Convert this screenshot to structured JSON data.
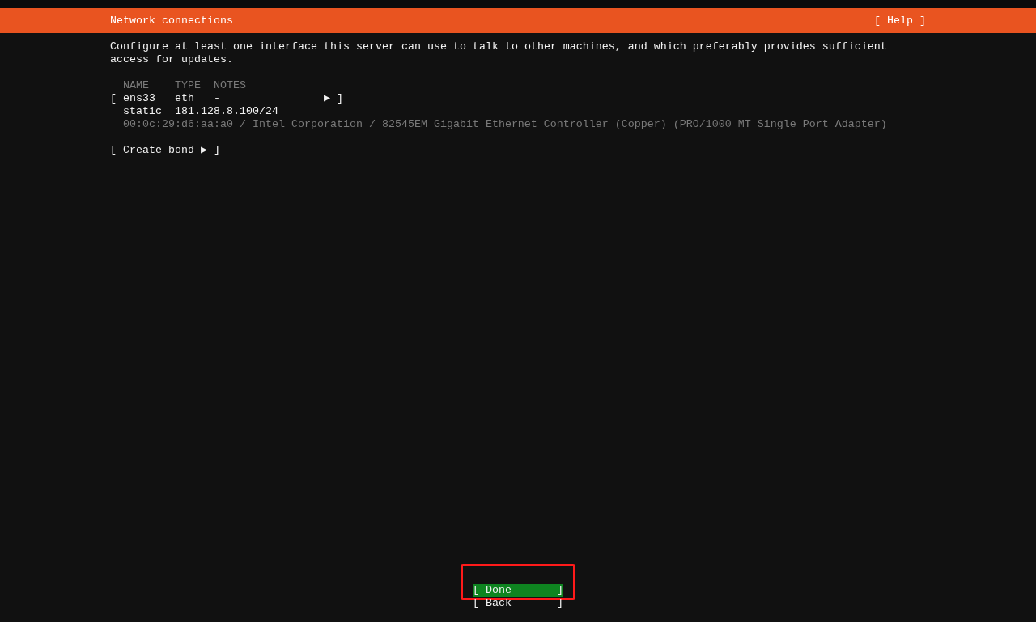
{
  "header": {
    "title": "Network connections",
    "help": "[ Help ]"
  },
  "intro": "Configure at least one interface this server can use to talk to other machines, and which preferably provides sufficient access for updates.",
  "columns": [
    "NAME",
    "TYPE",
    "NOTES"
  ],
  "interfaces": [
    {
      "left_bracket": "[",
      "name": "ens33",
      "type": "eth",
      "notes": "-",
      "arrow": "▶",
      "right_bracket": "]",
      "selected": false,
      "method": "static",
      "address": "181.128.8.100/24",
      "details": "00:0c:29:d6:aa:a0 / Intel Corporation / 82545EM Gigabit Ethernet Controller (Copper) (PRO/1000 MT Single Port Adapter)"
    }
  ],
  "create_bond": "[ Create bond ▶ ]",
  "buttons": [
    {
      "label": "[ Done       ]",
      "selected": true,
      "framed": true
    },
    {
      "label": "[ Back       ]",
      "selected": false,
      "framed": false
    }
  ]
}
